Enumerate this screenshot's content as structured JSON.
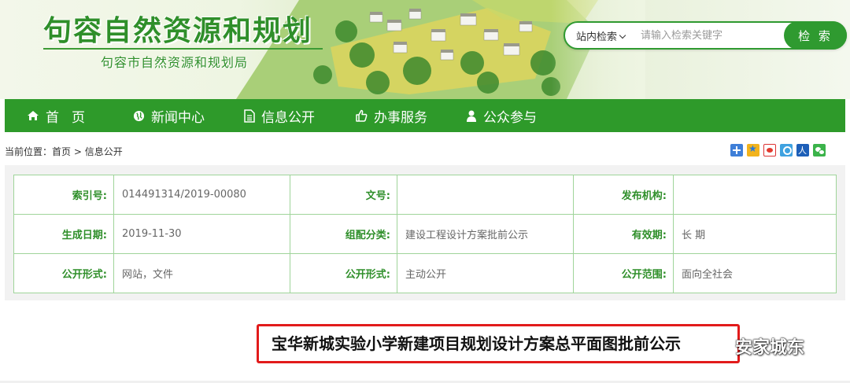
{
  "header": {
    "title": "句容自然资源和规划",
    "subtitle": "句容市自然资源和规划局",
    "search": {
      "scope_label": "站内检索",
      "placeholder": "请输入检索关键字",
      "button_label": "检 索"
    }
  },
  "nav": {
    "items": [
      {
        "label": "首页",
        "icon": "home-icon"
      },
      {
        "label": "新闻中心",
        "icon": "globe-icon"
      },
      {
        "label": "信息公开",
        "icon": "document-icon"
      },
      {
        "label": "办事服务",
        "icon": "thumbs-up-icon"
      },
      {
        "label": "公众参与",
        "icon": "user-icon"
      }
    ]
  },
  "breadcrumb": {
    "prefix": "当前位置：",
    "home": "首页",
    "separator": " > ",
    "current": "信息公开"
  },
  "share_icons": [
    "plus-share-icon",
    "qzone-icon",
    "weibo-icon",
    "tencent-weibo-icon",
    "renren-icon",
    "wechat-icon"
  ],
  "meta": {
    "rows": [
      [
        {
          "key": "索引号:",
          "value": "014491314/2019-00080"
        },
        {
          "key": "文号:",
          "value": ""
        },
        {
          "key": "发布机构:",
          "value": ""
        }
      ],
      [
        {
          "key": "生成日期:",
          "value": "2019-11-30"
        },
        {
          "key": "组配分类:",
          "value": "建设工程设计方案批前公示"
        },
        {
          "key": "有效期:",
          "value": "长 期"
        }
      ],
      [
        {
          "key": "公开形式:",
          "value": "网站，文件"
        },
        {
          "key": "公开形式:",
          "value": "主动公开"
        },
        {
          "key": "公开范围:",
          "value": "面向全社会"
        }
      ]
    ]
  },
  "article": {
    "title": "宝华新城实验小学新建项目规划设计方案总平面图批前公示"
  },
  "watermark": {
    "text": "安家城东"
  },
  "colors": {
    "brand_green": "#2e9a2a",
    "title_green": "#2f8f2a",
    "cell_border": "#9fd49a",
    "highlight_red": "#e21b1b"
  }
}
